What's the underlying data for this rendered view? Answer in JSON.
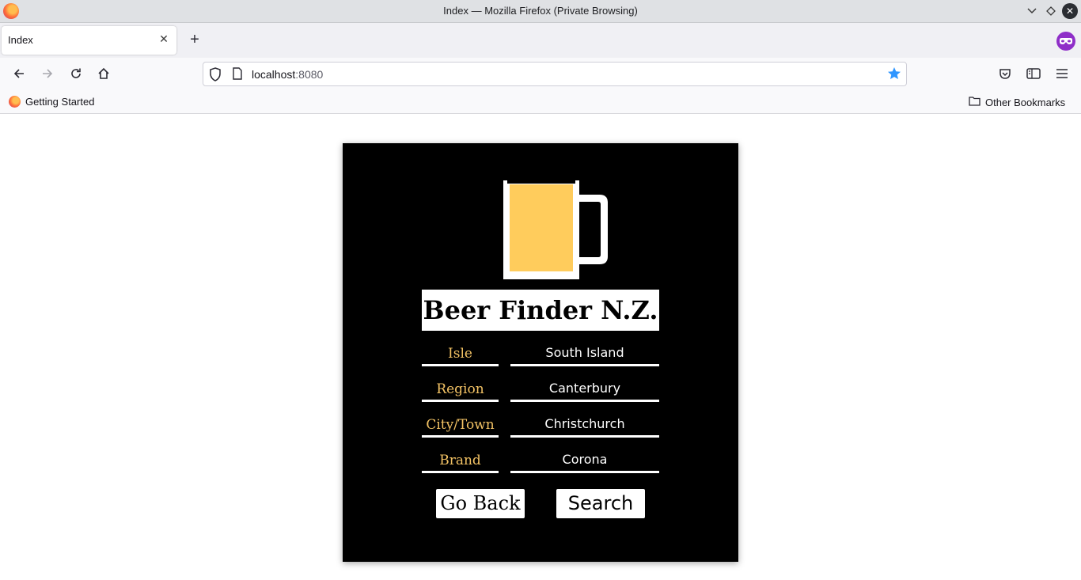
{
  "window": {
    "title": "Index — Mozilla Firefox (Private Browsing)"
  },
  "tabs": [
    {
      "label": "Index",
      "active": true
    }
  ],
  "navbar": {
    "url_host": "localhost",
    "url_port": ":8080",
    "bookmarked": true
  },
  "bookmarks": {
    "items": [
      {
        "label": "Getting Started",
        "icon": "firefox-icon"
      }
    ],
    "other": "Other Bookmarks"
  },
  "app": {
    "title": "Beer Finder N.Z.",
    "logo": "beer-mug-icon",
    "colors": {
      "card_bg": "#000000",
      "label_color": "#f2c264",
      "beer_fill": "#ffcc5c"
    },
    "fields": [
      {
        "label": "Isle",
        "value": "South Island"
      },
      {
        "label": "Region",
        "value": "Canterbury"
      },
      {
        "label": "City/Town",
        "value": "Christchurch"
      },
      {
        "label": "Brand",
        "value": "Corona"
      }
    ],
    "buttons": {
      "back": "Go Back",
      "search": "Search"
    }
  }
}
